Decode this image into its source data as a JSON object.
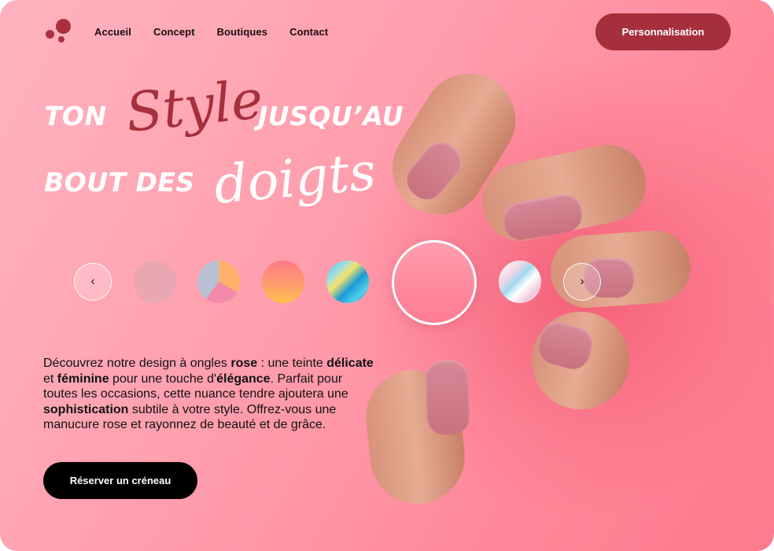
{
  "nav": {
    "items": [
      {
        "label": "Accueil"
      },
      {
        "label": "Concept"
      },
      {
        "label": "Boutiques"
      },
      {
        "label": "Contact"
      }
    ],
    "cta_label": "Personnalisation"
  },
  "hero": {
    "line1_a": "TON",
    "line1_script": "Style",
    "line1_b": "JUSQU’AU",
    "line2_a": "BOUT DES",
    "line2_script": "doigts"
  },
  "swatches": {
    "prev_icon": "chevron-left-icon",
    "next_icon": "chevron-right-icon",
    "items": [
      "pale-pink",
      "tricolor-pastel",
      "coral-gradient",
      "marble-blue",
      "selected-pink",
      "marble-white"
    ]
  },
  "description": {
    "p1": "Découvrez notre design à ongles ",
    "b1": "rose",
    "p2": " : une teinte ",
    "b2": "délicate",
    "p3": " et ",
    "b3": "féminine",
    "p4": " pour une touche d'",
    "b4": "élégance",
    "p5": ". Parfait pour toutes les occasions, cette nuance tendre ajoutera une ",
    "b5": "sophistication",
    "p6": " subtile à votre style. Offrez-vous une manucure rose et rayonnez de beauté et de grâce."
  },
  "cta_bottom_label": "Réserver un créneau",
  "colors": {
    "accent": "#a52f3b",
    "background": "#ff9fae",
    "button_dark": "#000000"
  }
}
